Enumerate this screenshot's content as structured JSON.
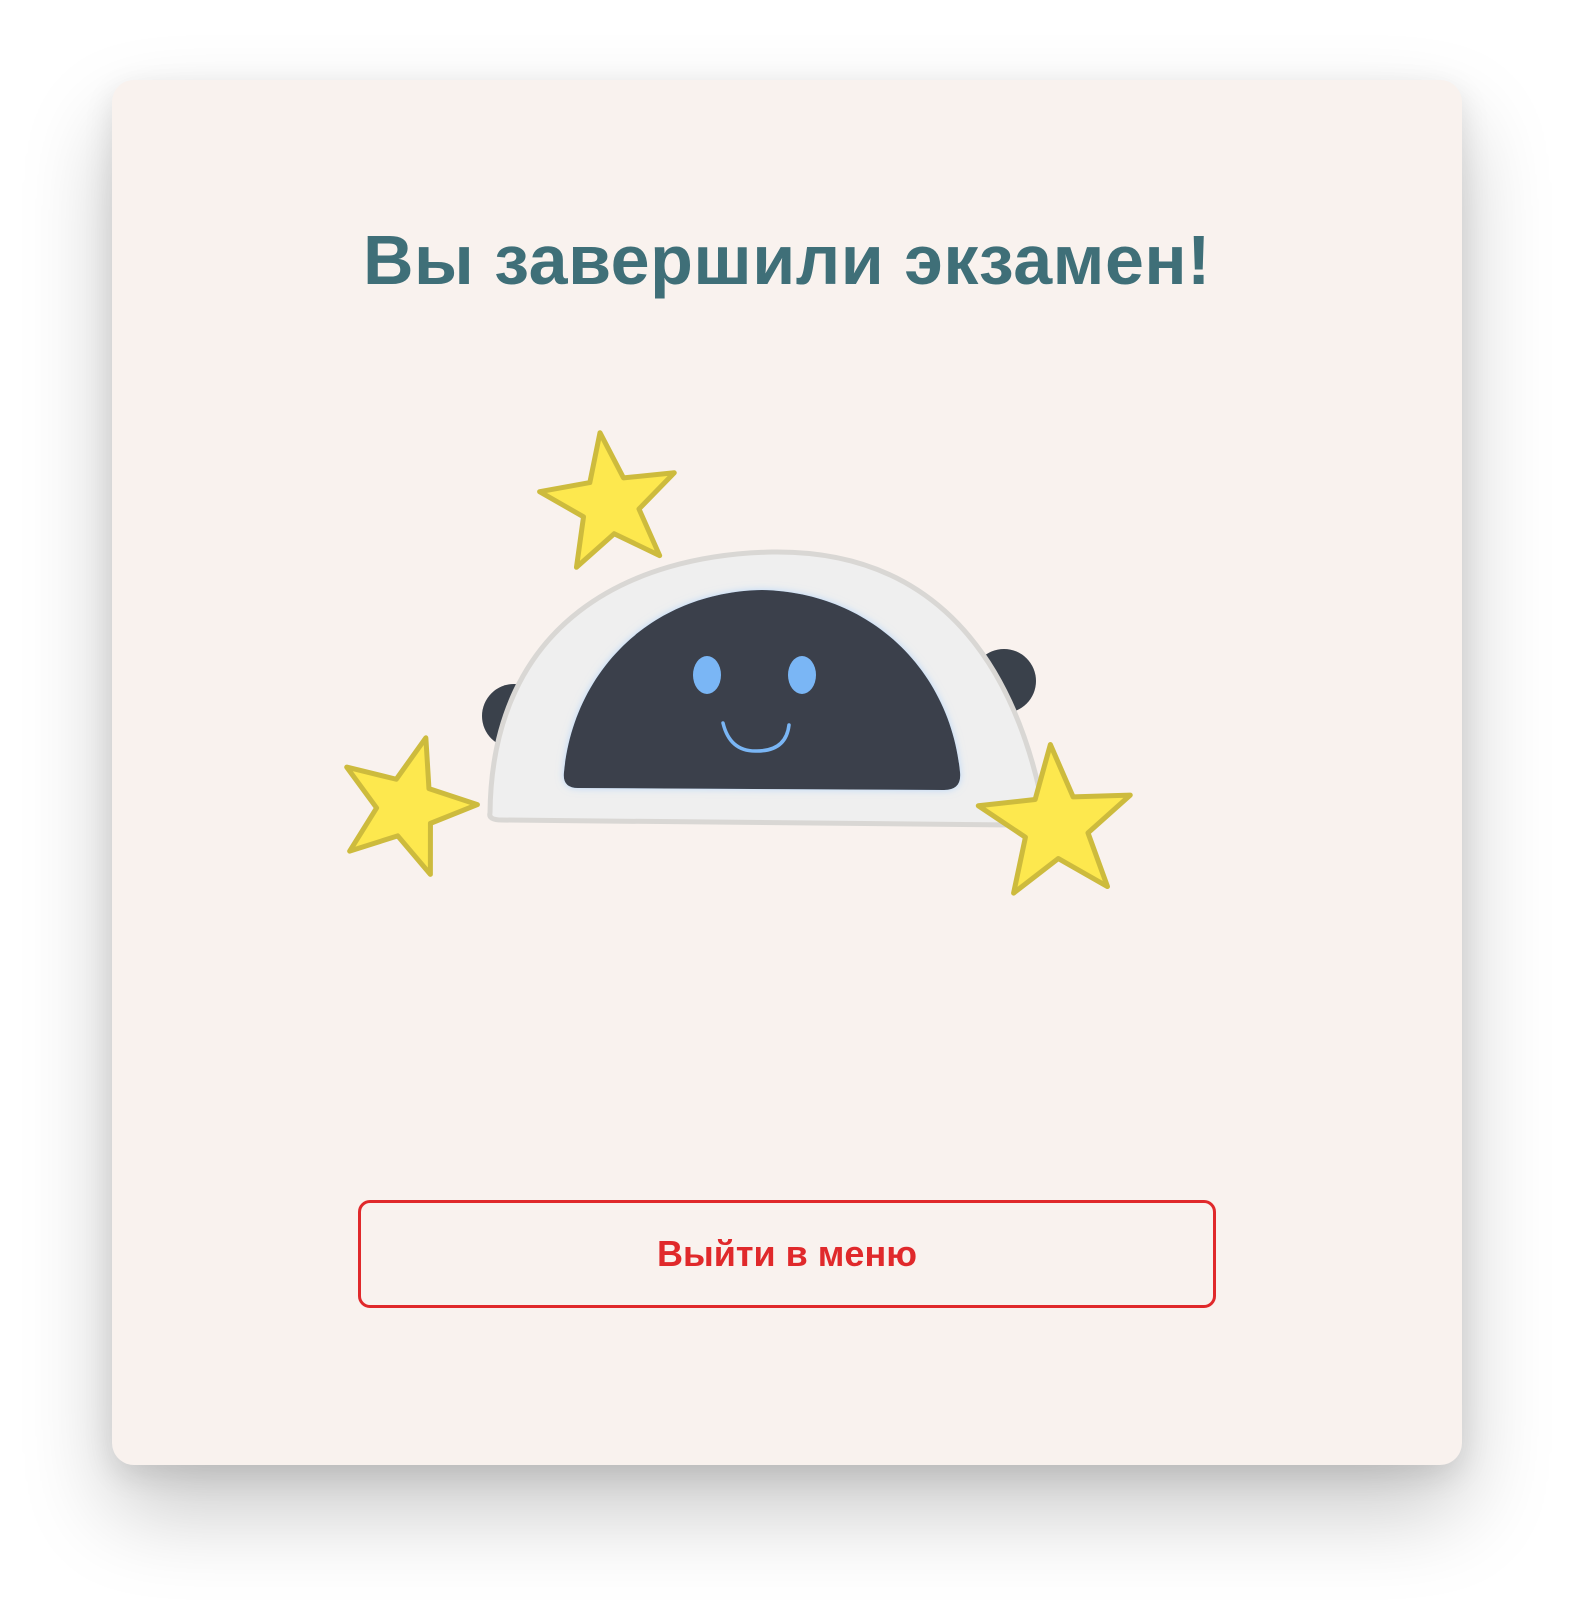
{
  "screen": {
    "title": "Вы завершили экзамен!",
    "exit_button_label": "Выйти в меню"
  },
  "illustration": {
    "name": "smiling-robot-with-stars",
    "colors": {
      "background": "#f9f2ee",
      "title": "#3f6f78",
      "accent_red": "#e0292b",
      "robot_shell": "#efefef",
      "robot_face": "#3a414b",
      "robot_eyes": "#7ab6f5",
      "star_fill": "#fde84e",
      "star_stroke": "#cdbb3d"
    }
  }
}
